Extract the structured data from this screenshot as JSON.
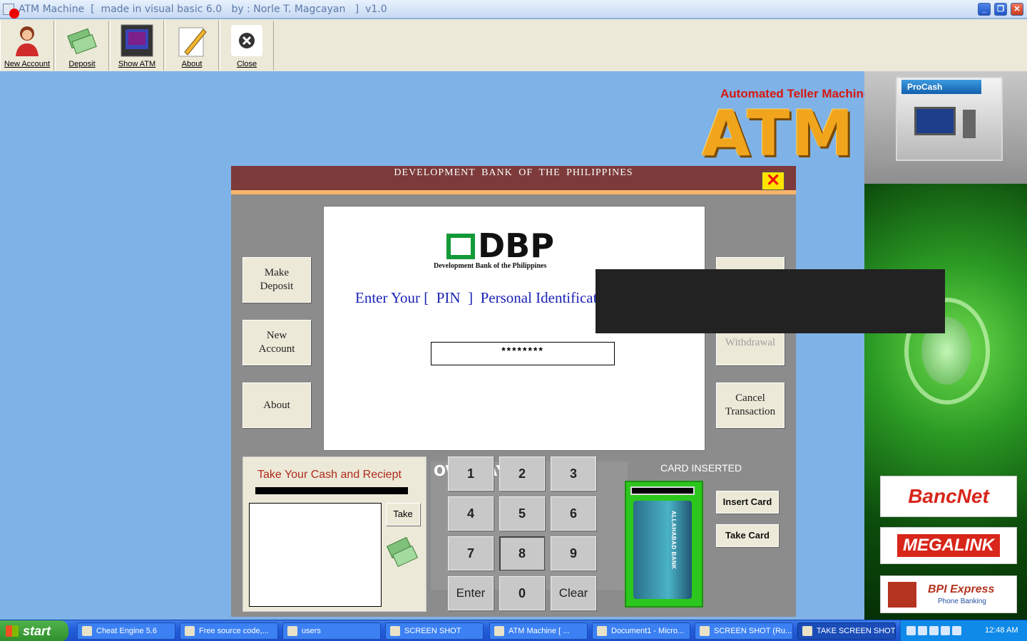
{
  "window": {
    "title": "ATM Machine  [  made in visual basic 6.0   by : Norle T. Magcayan   ]  v1.0",
    "controls": [
      "_",
      "❐",
      "✕"
    ]
  },
  "toolbar": {
    "buttons": [
      {
        "label": "New Account",
        "icon": "person-icon"
      },
      {
        "label": "Deposit",
        "icon": "money-icon"
      },
      {
        "label": "Show ATM",
        "icon": "atm-screen-icon"
      },
      {
        "label": "About",
        "icon": "pencil-icon"
      },
      {
        "label": "Close",
        "icon": "close-circle-icon"
      }
    ]
  },
  "logo": {
    "subtitle": "Automated Teller Machine",
    "big": "ATM",
    "procash": "ProCash"
  },
  "ads": {
    "bancnet": "BancNet",
    "megalink": "MEGALINK",
    "bpi_title": "BPI Express",
    "bpi_sub": "Phone Banking"
  },
  "atm": {
    "bank_name": "DEVELOPMENT  BANK  OF  THE   PHILIPPINES",
    "close_label": "✕",
    "left_buttons": [
      "Make\nDeposit",
      "New\nAccount",
      "About"
    ],
    "right_buttons": [
      "",
      "Withdrawal",
      "Cancel\nTransaction"
    ],
    "screen": {
      "logo_text": "DBP",
      "logo_sub": "Development Bank of the Philippines",
      "prompt": "Enter Your [  PIN  ]  Personal Identificat",
      "pin_value": "********"
    },
    "receipt": {
      "title": "Take Your Cash and Reciept",
      "take_label": "Take"
    },
    "keypad": {
      "overlay_label": "OVERLAY",
      "keys": [
        "1",
        "2",
        "3",
        "4",
        "5",
        "6",
        "7",
        "8",
        "9",
        "Enter",
        "0",
        "Clear"
      ]
    },
    "card": {
      "status": "CARD INSERTED",
      "card_text": "ALLAHABAD BANK",
      "insert_label": "Insert Card",
      "take_label": "Take Card"
    }
  },
  "taskbar": {
    "start_label": "start",
    "tasks": [
      "Cheat Engine 5.6",
      "Free source code,...",
      "users",
      "SCREEN SHOT",
      "ATM Machine  [  ...",
      "Document1 - Micro...",
      "SCREEN SHOT (Ru...",
      "TAKE SCREEN SHOT"
    ],
    "clock": "12:48 AM"
  }
}
